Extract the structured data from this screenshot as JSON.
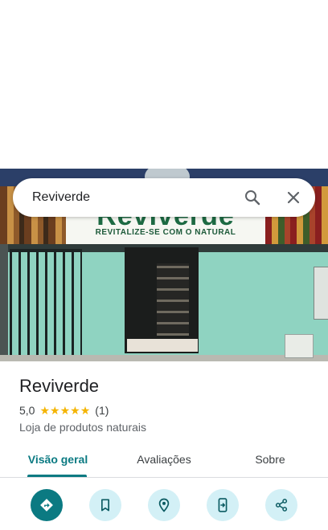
{
  "search": {
    "query": "Reviverde"
  },
  "photo": {
    "sign_name": "Reviverde",
    "sign_tagline": "REVITALIZE-SE COM O NATURAL"
  },
  "place": {
    "name": "Reviverde",
    "rating": "5,0",
    "stars": 5,
    "review_count": "(1)",
    "category": "Loja de produtos naturais"
  },
  "tabs": [
    {
      "label": "Visão geral",
      "active": true
    },
    {
      "label": "Avaliações",
      "active": false
    },
    {
      "label": "Sobre",
      "active": false
    }
  ],
  "actions": [
    {
      "icon": "directions-icon"
    },
    {
      "icon": "bookmark-icon"
    },
    {
      "icon": "nearby-icon"
    },
    {
      "icon": "send-to-phone-icon"
    },
    {
      "icon": "share-icon"
    }
  ],
  "colors": {
    "accent": "#0b7a82",
    "action_bg": "#d3f0f6",
    "star": "#f4b400"
  }
}
